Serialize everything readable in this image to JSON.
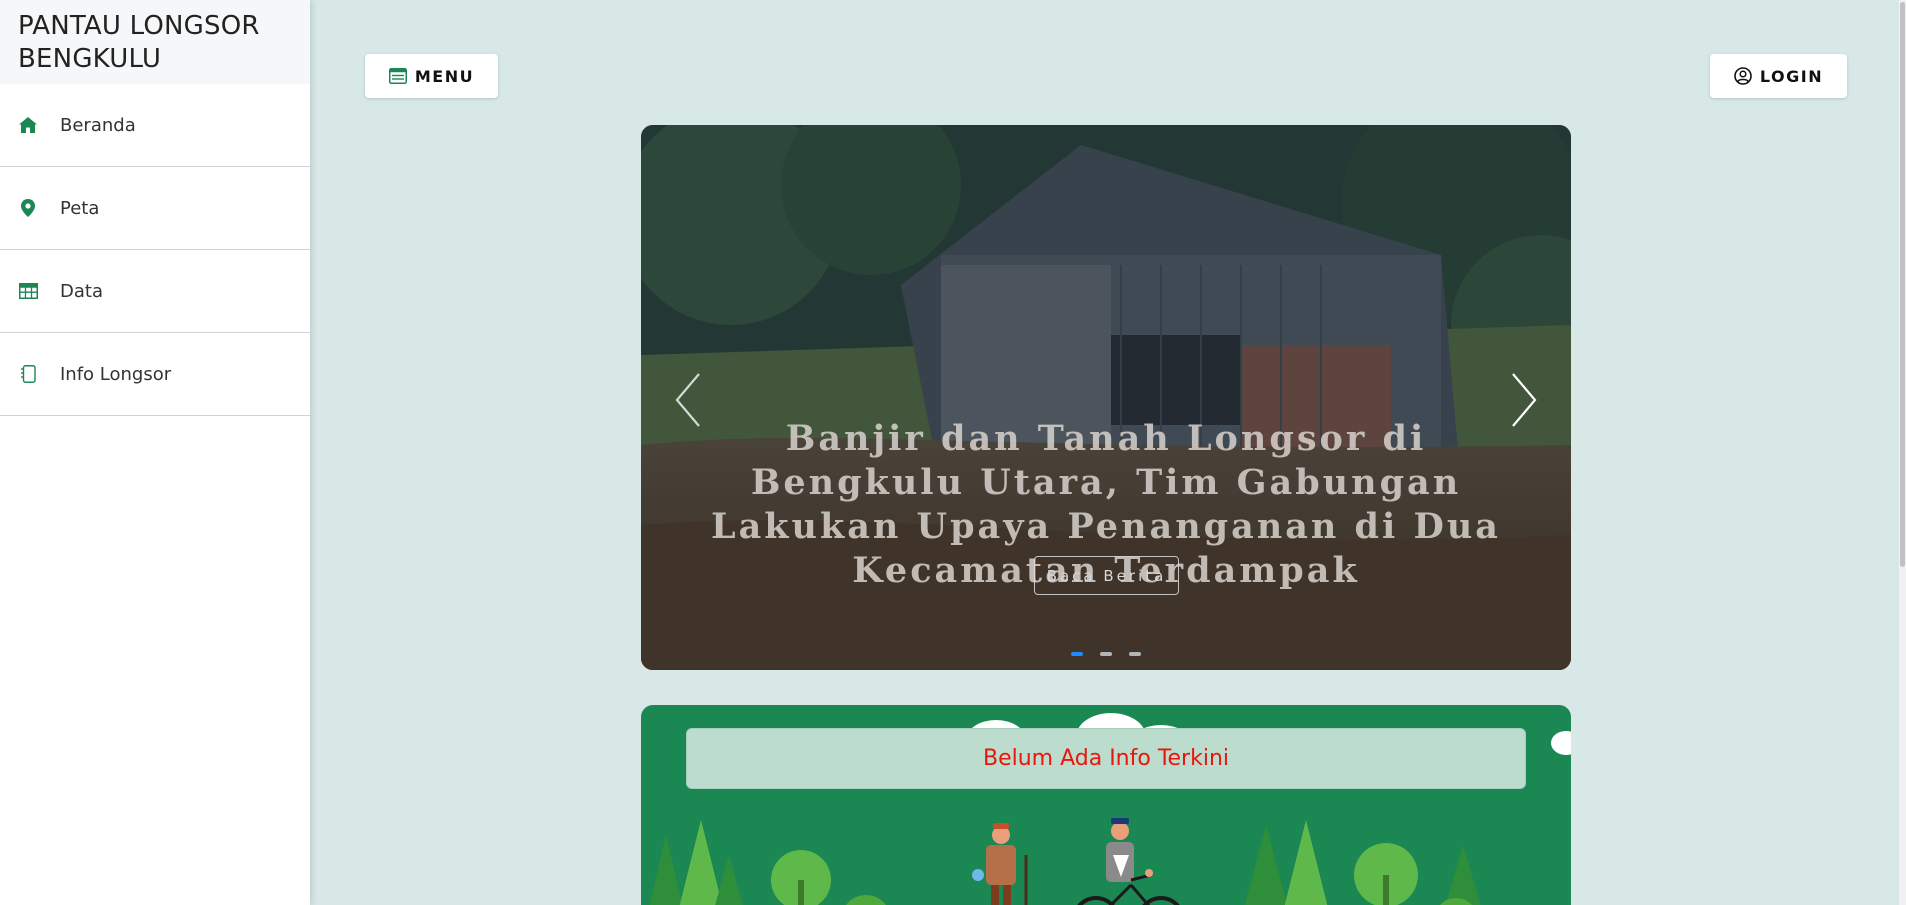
{
  "sidebar": {
    "brand": "PANTAU LONGSOR BENGKULU",
    "items": [
      {
        "label": "Beranda",
        "icon": "home-icon"
      },
      {
        "label": "Peta",
        "icon": "map-pin-icon"
      },
      {
        "label": "Data",
        "icon": "table-icon"
      },
      {
        "label": "Info Longsor",
        "icon": "document-icon"
      }
    ]
  },
  "header": {
    "menu_label": "MENU",
    "login_label": "LOGIN"
  },
  "carousel": {
    "caption": "Banjir dan Tanah Longsor di Bengkulu Utara, Tim Gabungan Lakukan Upaya Penanganan di Dua Kecamatan Terdampak",
    "button_label": "Baca Berita",
    "slide_count": 3,
    "active_index": 0
  },
  "info": {
    "message": "Belum Ada Info Terkini"
  },
  "colors": {
    "accent": "#1b8753",
    "background": "#d7e8e7",
    "alert_text": "#e8160c",
    "indicator_active": "#1e8bff"
  }
}
